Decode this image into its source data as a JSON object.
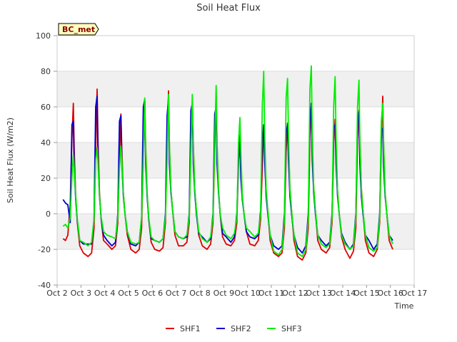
{
  "chart_data": {
    "type": "line",
    "title": "Soil Heat Flux",
    "xlabel": "Time",
    "ylabel": "Soil Heat Flux (W/m2)",
    "badge": "BC_met",
    "xlim": [
      2,
      17
    ],
    "ylim": [
      -40,
      100
    ],
    "x_ticks": [
      {
        "x": 2,
        "label": "Oct 2"
      },
      {
        "x": 3,
        "label": "Oct 3"
      },
      {
        "x": 4,
        "label": "Oct 4"
      },
      {
        "x": 5,
        "label": "Oct 5"
      },
      {
        "x": 6,
        "label": "Oct 6"
      },
      {
        "x": 7,
        "label": "Oct 7"
      },
      {
        "x": 8,
        "label": "Oct 8"
      },
      {
        "x": 9,
        "label": "Oct 9"
      },
      {
        "x": 10,
        "label": "Oct 10"
      },
      {
        "x": 11,
        "label": "Oct 11"
      },
      {
        "x": 12,
        "label": "Oct 12"
      },
      {
        "x": 13,
        "label": "Oct 13"
      },
      {
        "x": 14,
        "label": "Oct 14"
      },
      {
        "x": 15,
        "label": "Oct 15"
      },
      {
        "x": 16,
        "label": "Oct 16"
      },
      {
        "x": 17,
        "label": "Oct 17"
      }
    ],
    "y_ticks": [
      -40,
      -20,
      0,
      20,
      40,
      60,
      80,
      100
    ],
    "grid": true,
    "legend_position": "bottom-center",
    "series": [
      {
        "name": "SHF1",
        "color": "#dd0000",
        "x": [
          2.25,
          2.35,
          2.45,
          2.55,
          2.62,
          2.68,
          2.72,
          2.78,
          2.85,
          2.95,
          3.1,
          3.3,
          3.45,
          3.55,
          3.62,
          3.68,
          3.72,
          3.78,
          3.85,
          3.95,
          4.1,
          4.3,
          4.45,
          4.55,
          4.62,
          4.68,
          4.72,
          4.78,
          4.85,
          4.95,
          5.1,
          5.3,
          5.45,
          5.55,
          5.62,
          5.68,
          5.72,
          5.78,
          5.85,
          5.95,
          6.1,
          6.3,
          6.45,
          6.55,
          6.62,
          6.68,
          6.72,
          6.78,
          6.85,
          6.95,
          7.1,
          7.3,
          7.45,
          7.55,
          7.62,
          7.68,
          7.72,
          7.78,
          7.85,
          7.95,
          8.1,
          8.3,
          8.45,
          8.55,
          8.62,
          8.68,
          8.72,
          8.78,
          8.85,
          8.95,
          9.1,
          9.3,
          9.45,
          9.55,
          9.62,
          9.68,
          9.72,
          9.78,
          9.85,
          9.95,
          10.1,
          10.3,
          10.45,
          10.55,
          10.62,
          10.68,
          10.72,
          10.78,
          10.85,
          10.95,
          11.1,
          11.3,
          11.45,
          11.55,
          11.62,
          11.68,
          11.72,
          11.78,
          11.85,
          11.95,
          12.1,
          12.3,
          12.45,
          12.55,
          12.62,
          12.68,
          12.72,
          12.78,
          12.85,
          12.95,
          13.1,
          13.3,
          13.45,
          13.55,
          13.62,
          13.68,
          13.72,
          13.78,
          13.85,
          13.95,
          14.1,
          14.3,
          14.45,
          14.55,
          14.62,
          14.68,
          14.72,
          14.78,
          14.85,
          14.95,
          15.1,
          15.3,
          15.45,
          15.55,
          15.62,
          15.68,
          15.72,
          15.78,
          15.85,
          15.95,
          16.1
        ],
        "values": [
          -14,
          -15,
          -12,
          5,
          42,
          62,
          35,
          10,
          -5,
          -18,
          -22,
          -24,
          -22,
          -8,
          35,
          70,
          40,
          12,
          -3,
          -15,
          -17,
          -20,
          -18,
          -5,
          30,
          56,
          35,
          12,
          0,
          -12,
          -20,
          -22,
          -20,
          -8,
          35,
          64,
          38,
          12,
          -3,
          -16,
          -20,
          -21,
          -19,
          -5,
          38,
          69,
          38,
          14,
          2,
          -12,
          -18,
          -18,
          -16,
          -5,
          38,
          62,
          40,
          14,
          2,
          -12,
          -18,
          -20,
          -17,
          -5,
          36,
          67,
          38,
          14,
          0,
          -13,
          -17,
          -18,
          -15,
          -5,
          30,
          44,
          30,
          10,
          0,
          -10,
          -17,
          -18,
          -15,
          -3,
          25,
          49,
          35,
          12,
          2,
          -15,
          -22,
          -24,
          -22,
          -8,
          35,
          51,
          40,
          14,
          2,
          -15,
          -24,
          -26,
          -22,
          -8,
          42,
          62,
          40,
          15,
          2,
          -15,
          -20,
          -22,
          -19,
          -5,
          40,
          53,
          36,
          13,
          0,
          -13,
          -20,
          -25,
          -21,
          -8,
          42,
          58,
          40,
          15,
          2,
          -15,
          -22,
          -24,
          -20,
          -5,
          40,
          66,
          38,
          12,
          0,
          -15,
          -20
        ]
      },
      {
        "name": "SHF2",
        "color": "#0000cc",
        "x": [
          2.25,
          2.35,
          2.45,
          2.55,
          2.62,
          2.68,
          2.72,
          2.78,
          2.85,
          2.95,
          3.1,
          3.3,
          3.45,
          3.55,
          3.62,
          3.68,
          3.72,
          3.78,
          3.85,
          3.95,
          4.1,
          4.3,
          4.45,
          4.55,
          4.62,
          4.68,
          4.72,
          4.78,
          4.85,
          4.95,
          5.1,
          5.3,
          5.45,
          5.55,
          5.62,
          5.68,
          5.72,
          5.78,
          5.85,
          5.95,
          6.1,
          6.3,
          6.45,
          6.55,
          6.62,
          6.68,
          6.72,
          6.78,
          6.85,
          6.95,
          7.1,
          7.3,
          7.45,
          7.55,
          7.62,
          7.68,
          7.72,
          7.78,
          7.85,
          7.95,
          8.1,
          8.3,
          8.45,
          8.55,
          8.62,
          8.68,
          8.72,
          8.78,
          8.85,
          8.95,
          9.1,
          9.3,
          9.45,
          9.55,
          9.62,
          9.68,
          9.72,
          9.78,
          9.85,
          9.95,
          10.1,
          10.3,
          10.45,
          10.55,
          10.62,
          10.68,
          10.72,
          10.78,
          10.85,
          10.95,
          11.1,
          11.3,
          11.45,
          11.55,
          11.62,
          11.68,
          11.72,
          11.78,
          11.85,
          11.95,
          12.1,
          12.3,
          12.45,
          12.55,
          12.62,
          12.68,
          12.72,
          12.78,
          12.85,
          12.95,
          13.1,
          13.3,
          13.45,
          13.55,
          13.62,
          13.68,
          13.72,
          13.78,
          13.85,
          13.95,
          14.1,
          14.3,
          14.45,
          14.55,
          14.62,
          14.68,
          14.72,
          14.78,
          14.85,
          14.95,
          15.1,
          15.3,
          15.45,
          15.55,
          15.62,
          15.68,
          15.72,
          15.78,
          15.85,
          15.95,
          16.1
        ],
        "values": [
          8,
          6,
          5,
          -5,
          50,
          52,
          25,
          8,
          -4,
          -15,
          -17,
          -17,
          -17,
          -3,
          60,
          66,
          30,
          10,
          -3,
          -12,
          -15,
          -18,
          -16,
          0,
          52,
          55,
          28,
          10,
          0,
          -10,
          -17,
          -18,
          -16,
          -2,
          60,
          64,
          28,
          10,
          -3,
          -14,
          -15,
          -16,
          -14,
          0,
          55,
          65,
          28,
          12,
          2,
          -10,
          -13,
          -14,
          -13,
          0,
          58,
          62,
          28,
          12,
          0,
          -11,
          -13,
          -16,
          -14,
          0,
          56,
          60,
          28,
          12,
          0,
          -11,
          -13,
          -16,
          -13,
          0,
          30,
          40,
          20,
          8,
          0,
          -10,
          -13,
          -14,
          -12,
          2,
          40,
          50,
          30,
          10,
          0,
          -12,
          -18,
          -20,
          -18,
          0,
          45,
          50,
          30,
          10,
          0,
          -12,
          -19,
          -22,
          -18,
          0,
          50,
          62,
          30,
          12,
          0,
          -12,
          -15,
          -18,
          -16,
          0,
          48,
          50,
          28,
          10,
          0,
          -11,
          -16,
          -20,
          -17,
          0,
          50,
          57,
          28,
          10,
          0,
          -12,
          -15,
          -20,
          -17,
          0,
          46,
          48,
          26,
          10,
          0,
          -12,
          -15
        ]
      },
      {
        "name": "SHF3",
        "color": "#00ee00",
        "x": [
          2.25,
          2.35,
          2.45,
          2.55,
          2.62,
          2.68,
          2.72,
          2.78,
          2.85,
          2.95,
          3.1,
          3.3,
          3.45,
          3.55,
          3.62,
          3.68,
          3.72,
          3.78,
          3.85,
          3.95,
          4.1,
          4.3,
          4.45,
          4.55,
          4.62,
          4.68,
          4.72,
          4.78,
          4.85,
          4.95,
          5.1,
          5.3,
          5.45,
          5.55,
          5.62,
          5.68,
          5.72,
          5.78,
          5.85,
          5.95,
          6.1,
          6.3,
          6.45,
          6.55,
          6.62,
          6.68,
          6.72,
          6.78,
          6.85,
          6.95,
          7.1,
          7.3,
          7.45,
          7.55,
          7.62,
          7.68,
          7.72,
          7.78,
          7.85,
          7.95,
          8.1,
          8.3,
          8.45,
          8.55,
          8.62,
          8.68,
          8.72,
          8.78,
          8.85,
          8.95,
          9.1,
          9.3,
          9.45,
          9.55,
          9.62,
          9.68,
          9.72,
          9.78,
          9.85,
          9.95,
          10.1,
          10.3,
          10.45,
          10.55,
          10.62,
          10.68,
          10.72,
          10.78,
          10.85,
          10.95,
          11.1,
          11.3,
          11.45,
          11.55,
          11.62,
          11.68,
          11.72,
          11.78,
          11.85,
          11.95,
          12.1,
          12.3,
          12.45,
          12.55,
          12.62,
          12.68,
          12.72,
          12.78,
          12.85,
          12.95,
          13.1,
          13.3,
          13.45,
          13.55,
          13.62,
          13.68,
          13.72,
          13.78,
          13.85,
          13.95,
          14.1,
          14.3,
          14.45,
          14.55,
          14.62,
          14.68,
          14.72,
          14.78,
          14.85,
          14.95,
          15.1,
          15.3,
          15.45,
          15.55,
          15.62,
          15.68,
          15.72,
          15.78,
          15.85,
          15.95,
          16.1
        ],
        "values": [
          -7,
          -6,
          -8,
          -2,
          20,
          33,
          25,
          10,
          -3,
          -15,
          -16,
          -18,
          -16,
          -3,
          30,
          37,
          28,
          10,
          -2,
          -10,
          -12,
          -13,
          -14,
          -2,
          25,
          38,
          30,
          12,
          0,
          -10,
          -16,
          -17,
          -16,
          -2,
          30,
          65,
          35,
          12,
          -2,
          -13,
          -15,
          -16,
          -14,
          -2,
          30,
          67,
          38,
          14,
          2,
          -10,
          -13,
          -14,
          -12,
          -2,
          35,
          67,
          38,
          14,
          2,
          -10,
          -14,
          -16,
          -13,
          -2,
          40,
          72,
          40,
          14,
          0,
          -8,
          -12,
          -14,
          -11,
          -2,
          40,
          54,
          35,
          10,
          0,
          -8,
          -10,
          -13,
          -11,
          0,
          60,
          80,
          45,
          14,
          2,
          -12,
          -21,
          -23,
          -20,
          -3,
          65,
          76,
          45,
          14,
          2,
          -12,
          -22,
          -24,
          -20,
          -3,
          70,
          83,
          45,
          15,
          2,
          -12,
          -17,
          -19,
          -17,
          -2,
          60,
          77,
          42,
          13,
          0,
          -12,
          -17,
          -20,
          -18,
          -2,
          60,
          75,
          42,
          14,
          2,
          -12,
          -19,
          -21,
          -19,
          -2,
          52,
          62,
          38,
          12,
          0,
          -12,
          -17
        ]
      }
    ]
  }
}
